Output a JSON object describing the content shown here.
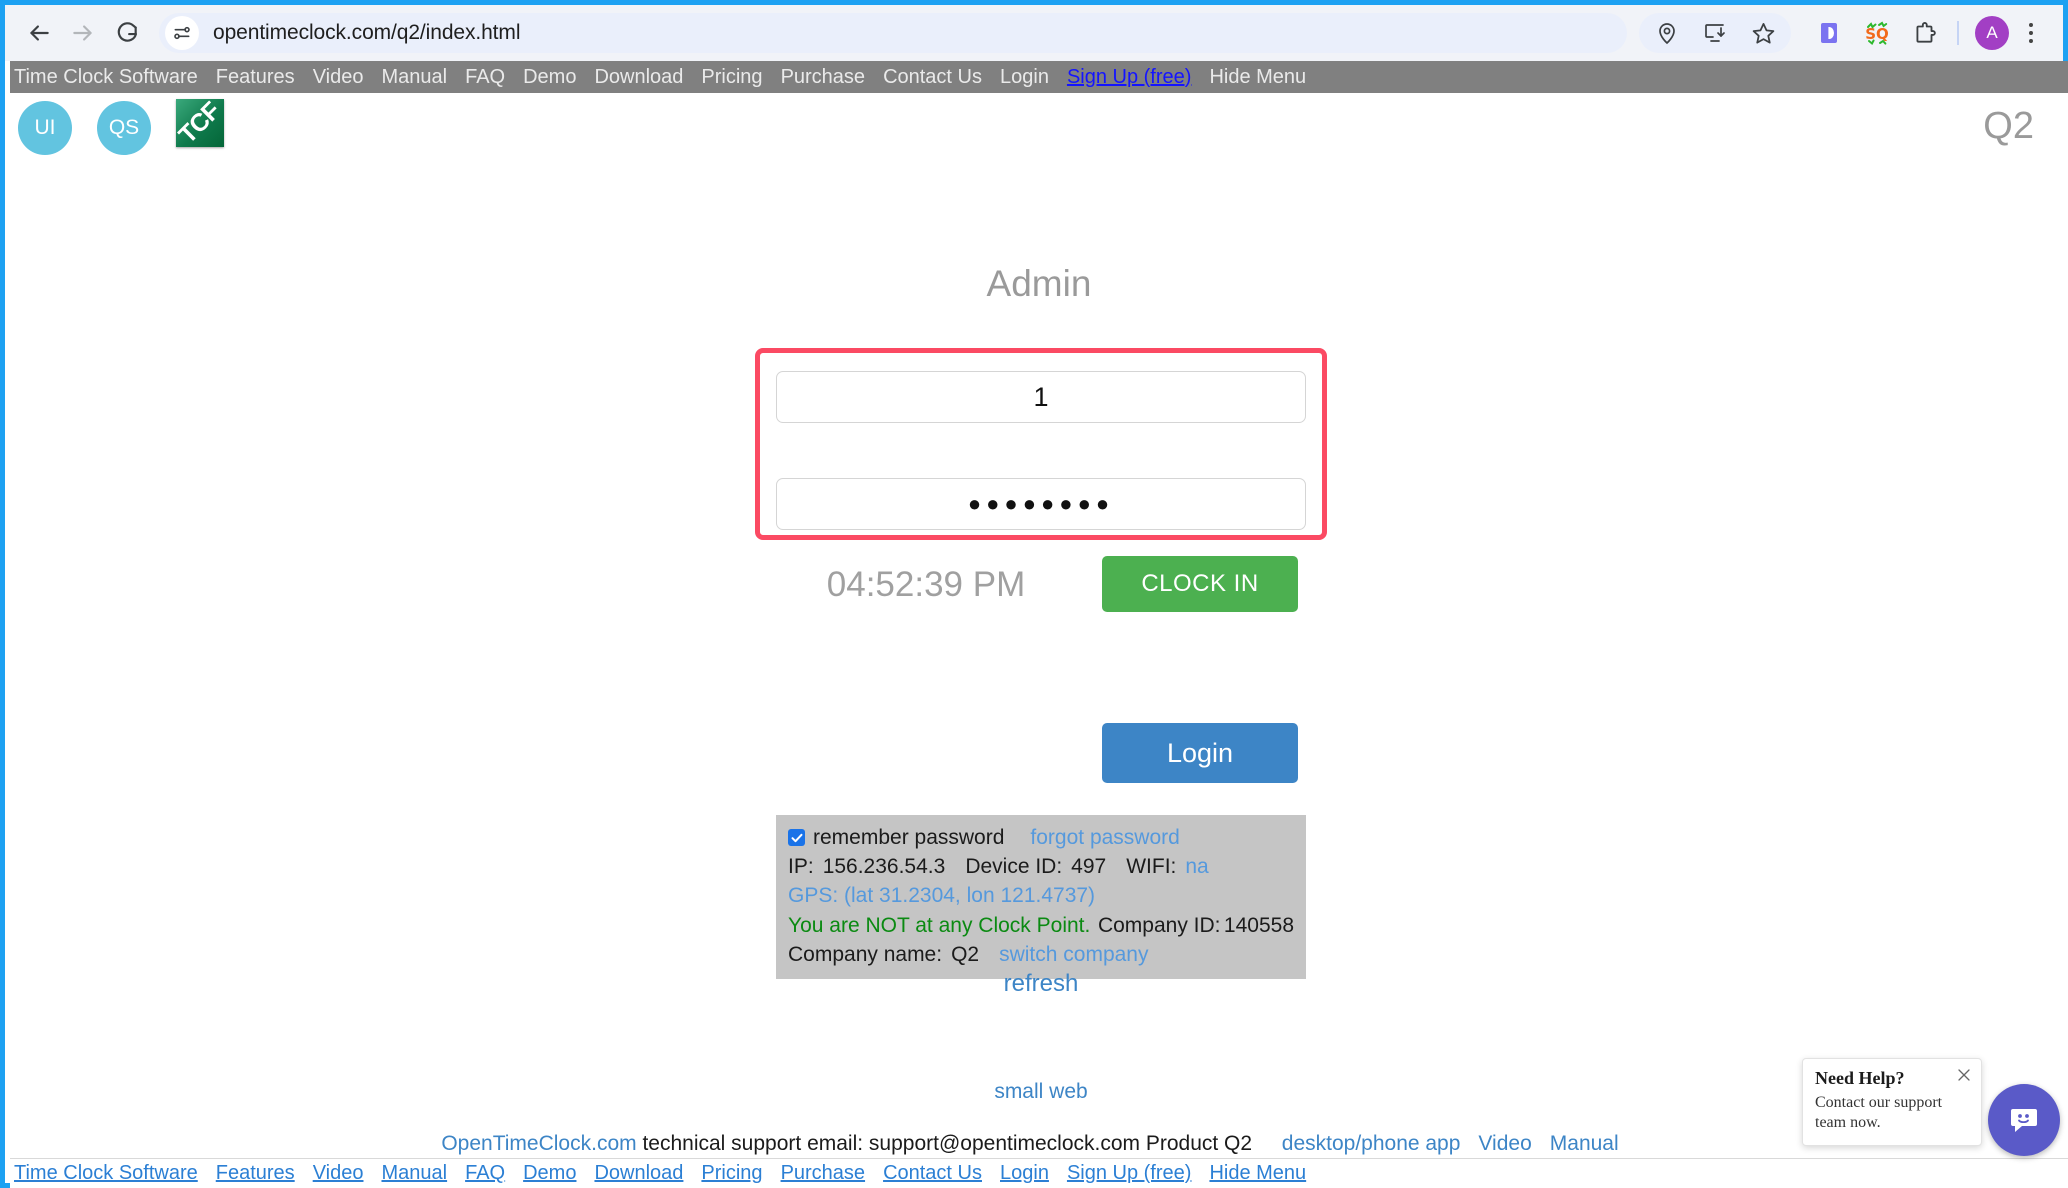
{
  "browser": {
    "url": "opentimeclock.com/q2/index.html",
    "back_label": "Back",
    "forward_label": "Forward",
    "reload_label": "Reload",
    "profile_initial": "A",
    "icons": {
      "site_settings": "tune-icon",
      "location": "location-pin-icon",
      "install": "install-app-icon",
      "bookmark": "star-icon",
      "extension_d": "extension-d-icon",
      "extension_sq": "extension-sq-icon",
      "extensions": "puzzle-piece-icon",
      "menu": "three-dot-menu-icon"
    }
  },
  "top_nav": {
    "items": [
      {
        "label": "Time Clock Software",
        "highlight": false
      },
      {
        "label": "Features",
        "highlight": false
      },
      {
        "label": "Video",
        "highlight": false
      },
      {
        "label": "Manual",
        "highlight": false
      },
      {
        "label": "FAQ",
        "highlight": false
      },
      {
        "label": "Demo",
        "highlight": false
      },
      {
        "label": "Download",
        "highlight": false
      },
      {
        "label": "Pricing",
        "highlight": false
      },
      {
        "label": "Purchase",
        "highlight": false
      },
      {
        "label": "Contact Us",
        "highlight": false
      },
      {
        "label": "Login",
        "highlight": false
      },
      {
        "label": "Sign Up (free)",
        "highlight": true
      },
      {
        "label": "Hide Menu",
        "highlight": false
      }
    ]
  },
  "header": {
    "badge_ui": "UI",
    "badge_qs": "QS",
    "logo_text": "TCF",
    "product_tag": "Q2"
  },
  "login": {
    "heading": "Admin",
    "username_value": "1",
    "username_placeholder": "",
    "password_value": "●●●●●●●●",
    "password_placeholder": "",
    "clock_time": "04:52:39 PM",
    "clock_in_label": "CLOCK IN",
    "login_label": "Login",
    "refresh_label": "refresh",
    "highlight_color": "#fb4a63",
    "clock_in_color": "#4cb050",
    "login_color": "#3d85c6"
  },
  "info_panel": {
    "remember_label": "remember password",
    "remember_checked": true,
    "forgot_label": "forgot password",
    "ip_label": "IP:",
    "ip_value": "156.236.54.3",
    "device_label": "Device ID:",
    "device_value": "497",
    "wifi_label": "WIFI:",
    "wifi_value": "na",
    "gps_text": "GPS: (lat 31.2304, lon 121.4737)",
    "clock_point_status": "You are NOT at any Clock Point.",
    "company_id_label": "Company ID:",
    "company_id_value": "140558",
    "company_name_label": "Company name:",
    "company_name_value": "Q2",
    "switch_company_label": "switch company"
  },
  "footer": {
    "small_web_label": "small web",
    "site_link": "OpenTimeClock.com",
    "support_text": "technical support email: support@opentimeclock.com Product Q2",
    "links": [
      {
        "label": "desktop/phone app"
      },
      {
        "label": "Video"
      },
      {
        "label": "Manual"
      }
    ]
  },
  "bottom_nav": {
    "items": [
      {
        "label": "Time Clock Software"
      },
      {
        "label": "Features"
      },
      {
        "label": "Video"
      },
      {
        "label": "Manual"
      },
      {
        "label": "FAQ"
      },
      {
        "label": "Demo"
      },
      {
        "label": "Download"
      },
      {
        "label": "Pricing"
      },
      {
        "label": "Purchase"
      },
      {
        "label": "Contact Us"
      },
      {
        "label": "Login"
      },
      {
        "label": "Sign Up (free)"
      },
      {
        "label": "Hide Menu"
      }
    ]
  },
  "chat_widget": {
    "title": "Need Help?",
    "text": "Contact our support team now.",
    "accent_color": "#5a5ac8"
  }
}
